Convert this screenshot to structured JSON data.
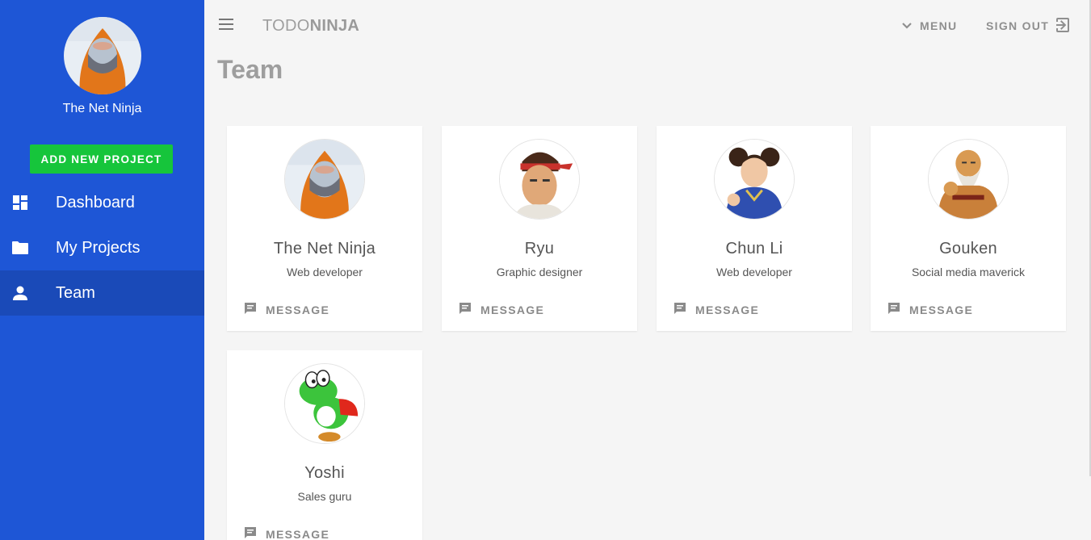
{
  "sidebar": {
    "profile_name": "The Net Ninja",
    "add_button_label": "ADD NEW PROJECT",
    "items": [
      {
        "label": "Dashboard",
        "icon": "dashboard-icon",
        "active": false
      },
      {
        "label": "My Projects",
        "icon": "folder-icon",
        "active": false
      },
      {
        "label": "Team",
        "icon": "person-icon",
        "active": true
      }
    ]
  },
  "toolbar": {
    "brand_light": "TODO",
    "brand_bold": "NINJA",
    "menu_label": "MENU",
    "signout_label": "SIGN OUT"
  },
  "page": {
    "title": "Team"
  },
  "team": [
    {
      "name": "The Net Ninja",
      "role": "Web developer",
      "action": "MESSAGE"
    },
    {
      "name": "Ryu",
      "role": "Graphic designer",
      "action": "MESSAGE"
    },
    {
      "name": "Chun Li",
      "role": "Web developer",
      "action": "MESSAGE"
    },
    {
      "name": "Gouken",
      "role": "Social media maverick",
      "action": "MESSAGE"
    },
    {
      "name": "Yoshi",
      "role": "Sales guru",
      "action": "MESSAGE"
    }
  ],
  "colors": {
    "sidebar": "#1e56d6",
    "sidebar_active": "#1a4ab8",
    "add_button": "#16c53b",
    "background": "#f5f5f5"
  }
}
